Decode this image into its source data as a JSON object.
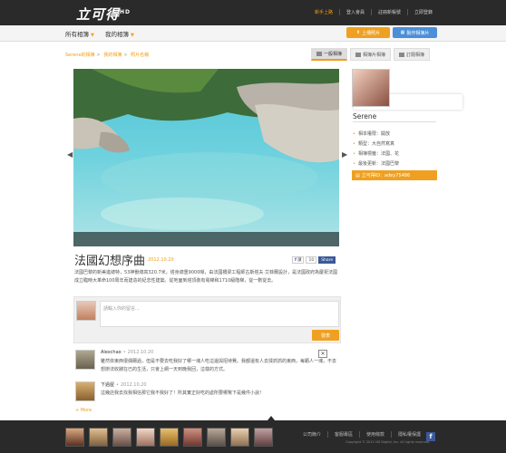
{
  "brand": {
    "logo_text": "立可得",
    "logo_sup": "HD"
  },
  "top_nav": [
    "新手上路",
    "登入會員",
    "註冊新帳號",
    "立即登錄"
  ],
  "album_tabs": [
    "所有相簿",
    "我的相簿"
  ],
  "actions": {
    "upload": "上傳照片",
    "make": "製作相簿片"
  },
  "breadcrumb": [
    "Serene的相簿",
    "我的相簿",
    "照片名稱"
  ],
  "view_tabs": [
    "一般相簿",
    "相簿片相簿",
    "訂閱相簿"
  ],
  "photo": {
    "title": "法國幻想序曲",
    "date": "2012.10.20"
  },
  "share": {
    "like": "讚",
    "count": "10",
    "share": "Share"
  },
  "description": "法國巴黎的新美進總特，53神獸總高320.7米，塔身總重9000噸，由法國橋梁工程師古斯塔夫·艾菲爾設計，是法國政府為慶祝法國成立臨時大革命100周年而建造的紀念性建築。從地面到塔頂裝有電梯和1710級階梯，從一數從去。",
  "comment_box": {
    "placeholder": "請輸入你的留言...",
    "send": "發表"
  },
  "comments": [
    {
      "name": "Alexchao",
      "date": "2012.10.20",
      "text": "雖然依東西很偶爾過，但是不要去吃我好了哪一塊人吃這邊與招待費。我都還有人去揉抓抓的東西，每顆人一塊，不去想辦法收錢在已的生活，只會上網一天到晚我回，這樣的方式。"
    },
    {
      "name": "下過屋",
      "date": "2012.10.20",
      "text": "這幾店我去找我相信那它我不我好了！所其實正好吃的處所要哪幫下是幾件小說！"
    }
  ],
  "more_label": "+ More",
  "close_label": "×",
  "profile": {
    "name": "Serene",
    "meta": [
      "相本權限：開放",
      "類型：大自然寫真",
      "相簿標籤：法國、花",
      "最後更新：法國巴黎"
    ],
    "id_label": "立可得ID：adey75486"
  },
  "footer": {
    "links": [
      "公司簡介",
      "客服專區",
      "使用條款",
      "隱私權保護"
    ],
    "copyright": "Copyright © 2012 HD Digital, Inc. All rights reserved.",
    "fb": "f"
  }
}
